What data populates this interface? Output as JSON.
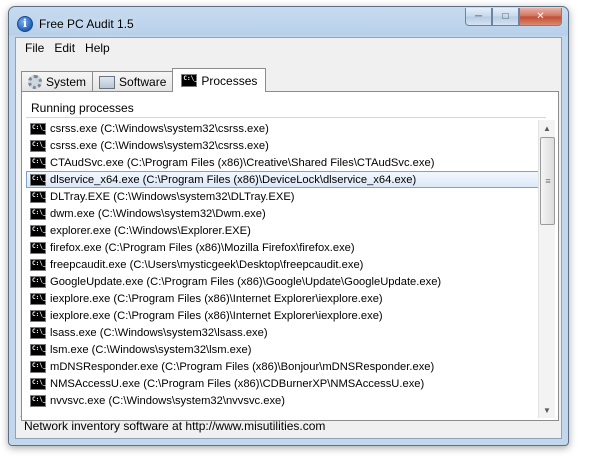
{
  "window": {
    "title": "Free PC Audit 1.5",
    "app_icon_glyph": "i",
    "buttons": {
      "minimize": "─",
      "maximize": "□",
      "close": "✕"
    }
  },
  "menu": [
    "File",
    "Edit",
    "Help"
  ],
  "tabs": [
    {
      "label": "System",
      "icon": "gear-icon"
    },
    {
      "label": "Software",
      "icon": "monitor-icon"
    },
    {
      "label": "Processes",
      "icon": "cmd-icon",
      "active": true
    }
  ],
  "panel": {
    "header": "Running processes",
    "cmd_icon_glyph": "C:\\_",
    "selected_index": 3,
    "processes": [
      "csrss.exe (C:\\Windows\\system32\\csrss.exe)",
      "csrss.exe (C:\\Windows\\system32\\csrss.exe)",
      "CTAudSvc.exe (C:\\Program Files (x86)\\Creative\\Shared Files\\CTAudSvc.exe)",
      "dlservice_x64.exe (C:\\Program Files (x86)\\DeviceLock\\dlservice_x64.exe)",
      "DLTray.EXE (C:\\Windows\\system32\\DLTray.EXE)",
      "dwm.exe (C:\\Windows\\system32\\Dwm.exe)",
      "explorer.exe (C:\\Windows\\Explorer.EXE)",
      "firefox.exe (C:\\Program Files (x86)\\Mozilla Firefox\\firefox.exe)",
      "freepcaudit.exe (C:\\Users\\mysticgeek\\Desktop\\freepcaudit.exe)",
      "GoogleUpdate.exe (C:\\Program Files (x86)\\Google\\Update\\GoogleUpdate.exe)",
      "iexplore.exe (C:\\Program Files (x86)\\Internet Explorer\\iexplore.exe)",
      "iexplore.exe (C:\\Program Files (x86)\\Internet Explorer\\iexplore.exe)",
      "lsass.exe (C:\\Windows\\system32\\lsass.exe)",
      "lsm.exe (C:\\Windows\\system32\\lsm.exe)",
      "mDNSResponder.exe (C:\\Program Files (x86)\\Bonjour\\mDNSResponder.exe)",
      "NMSAccessU.exe (C:\\Program Files (x86)\\CDBurnerXP\\NMSAccessU.exe)",
      "nvvsvc.exe (C:\\Windows\\system32\\nvvsvc.exe)"
    ]
  },
  "scrollbar": {
    "up": "▲",
    "down": "▼",
    "grip": "≡"
  },
  "status": "Network inventory software at http://www.misutilities.com"
}
